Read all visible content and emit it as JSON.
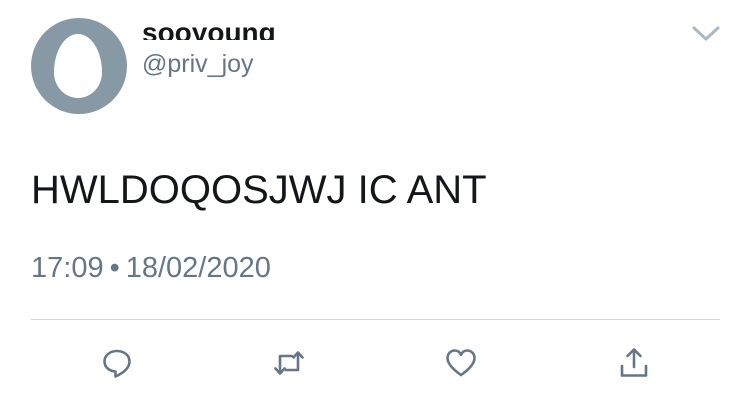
{
  "tweet": {
    "author": {
      "display_name": "sooyoung",
      "handle": "@priv_joy",
      "avatar_icon": "default-egg-avatar"
    },
    "text": "HWLDOQOSJWJ IC ANT",
    "time": "17:09",
    "separator": "•",
    "date": "18/02/2020"
  },
  "actions": {
    "reply_icon": "reply-icon",
    "retweet_icon": "retweet-icon",
    "like_icon": "heart-icon",
    "share_icon": "share-icon",
    "menu_icon": "chevron-down-icon"
  },
  "colors": {
    "text": "#14171a",
    "secondary": "#657786",
    "icon": "#657786",
    "avatar_bg": "#8899a6",
    "divider": "#ccd6dd",
    "chevron": "#aab8c2"
  }
}
